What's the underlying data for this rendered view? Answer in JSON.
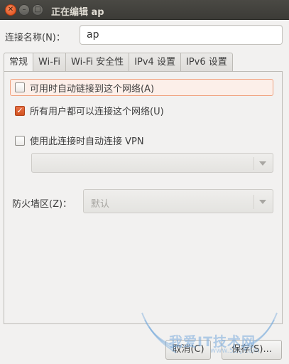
{
  "window": {
    "title": "正在编辑 ap",
    "close_glyph": "✕",
    "min_glyph": "–",
    "max_glyph": "□"
  },
  "connection": {
    "label": "连接名称(N)：",
    "value": "ap"
  },
  "tabs": [
    {
      "label": "常规",
      "active": true
    },
    {
      "label": "Wi-Fi",
      "active": false
    },
    {
      "label": "Wi-Fi 安全性",
      "active": false
    },
    {
      "label": "IPv4 设置",
      "active": false
    },
    {
      "label": "IPv6 设置",
      "active": false
    }
  ],
  "general": {
    "auto_connect": {
      "label": "可用时自动链接到这个网络(A)",
      "checked": false
    },
    "all_users": {
      "label": "所有用户都可以连接这个网络(U)",
      "checked": true
    },
    "auto_vpn": {
      "label": "使用此连接时自动连接 VPN",
      "checked": false
    },
    "vpn_select": {
      "value": ""
    },
    "firewall": {
      "label": "防火墙区(Z)：",
      "value": "默认"
    }
  },
  "buttons": {
    "cancel": "取消(C)",
    "save": "保存(S)..."
  },
  "watermark": {
    "text": "我爱IT技术网",
    "url": "www.52ij.com"
  },
  "colors": {
    "accent": "#dd4814",
    "titlebar": "#3c3b37",
    "background": "#f2f1f0"
  }
}
